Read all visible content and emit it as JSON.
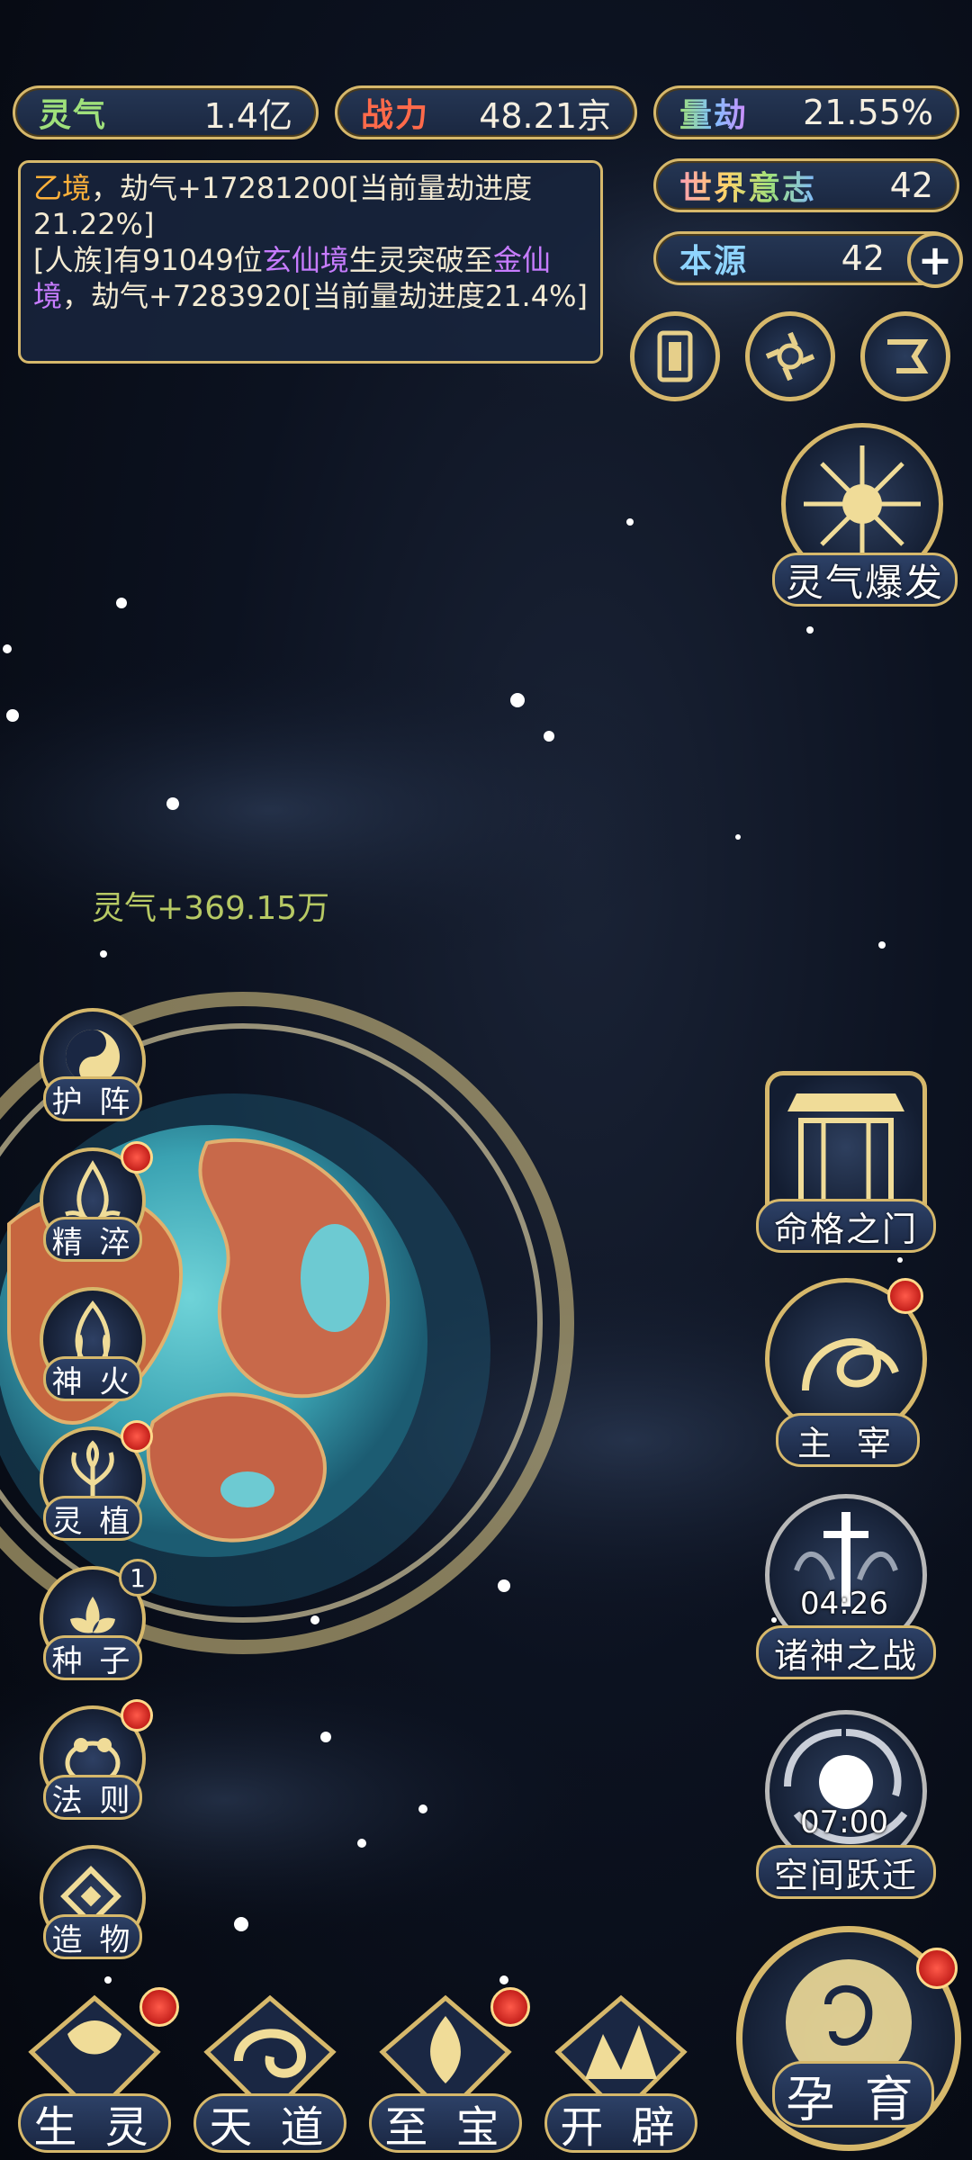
{
  "stats": {
    "lingqi": {
      "label": "灵气",
      "value": "1.4亿"
    },
    "zhanli": {
      "label": "战力",
      "value": "48.21京"
    },
    "liangjie": {
      "label": "量劫",
      "value": "21.55%"
    },
    "shijie_yizhi": {
      "label": "世界意志",
      "value": "42"
    },
    "benyuan": {
      "label": "本源",
      "value": "42"
    }
  },
  "log": {
    "line1_prefix": "乙境",
    "line1_rest": "，劫气+17281200[当前量劫进度21.22%]",
    "line2_a": "[人族]有91049位",
    "line2_b": "玄仙境",
    "line2_c": "生灵突破至",
    "line2_d": "金仙境",
    "line2_e": "，劫气+7283920[当前量劫进度21.4%]"
  },
  "float_gain": "灵气+369.15万",
  "right_buttons": {
    "burst": "灵气爆发",
    "fate_gate": "命格之门",
    "ruler": "主 宰",
    "gods_war": {
      "label": "诸神之战",
      "timer": "04:26"
    },
    "space_jump": {
      "label": "空间跃迁",
      "timer": "07:00"
    }
  },
  "left_buttons": [
    {
      "label": "护 阵",
      "icon": "yin-yang-icon",
      "dot": false
    },
    {
      "label": "精 淬",
      "icon": "lotus-flame-icon",
      "dot": true
    },
    {
      "label": "神 火",
      "icon": "divine-fire-icon",
      "dot": false
    },
    {
      "label": "灵 植",
      "icon": "spirit-plant-icon",
      "dot": true
    },
    {
      "label": "种 子",
      "icon": "seed-flower-icon",
      "badge": "1"
    },
    {
      "label": "法 则",
      "icon": "law-toad-icon",
      "dot": true
    },
    {
      "label": "造 物",
      "icon": "creation-diamond-icon",
      "dot": false
    }
  ],
  "bottom_buttons": [
    {
      "label": "生 灵",
      "dot": true
    },
    {
      "label": "天 道",
      "dot": false
    },
    {
      "label": "至 宝",
      "dot": true
    },
    {
      "label": "开 辟",
      "dot": false
    }
  ],
  "main_button": {
    "label": "孕 育"
  },
  "colors": {
    "gold": "#d6b86b",
    "panel": "#1a2740",
    "dot": "#d8271f"
  }
}
